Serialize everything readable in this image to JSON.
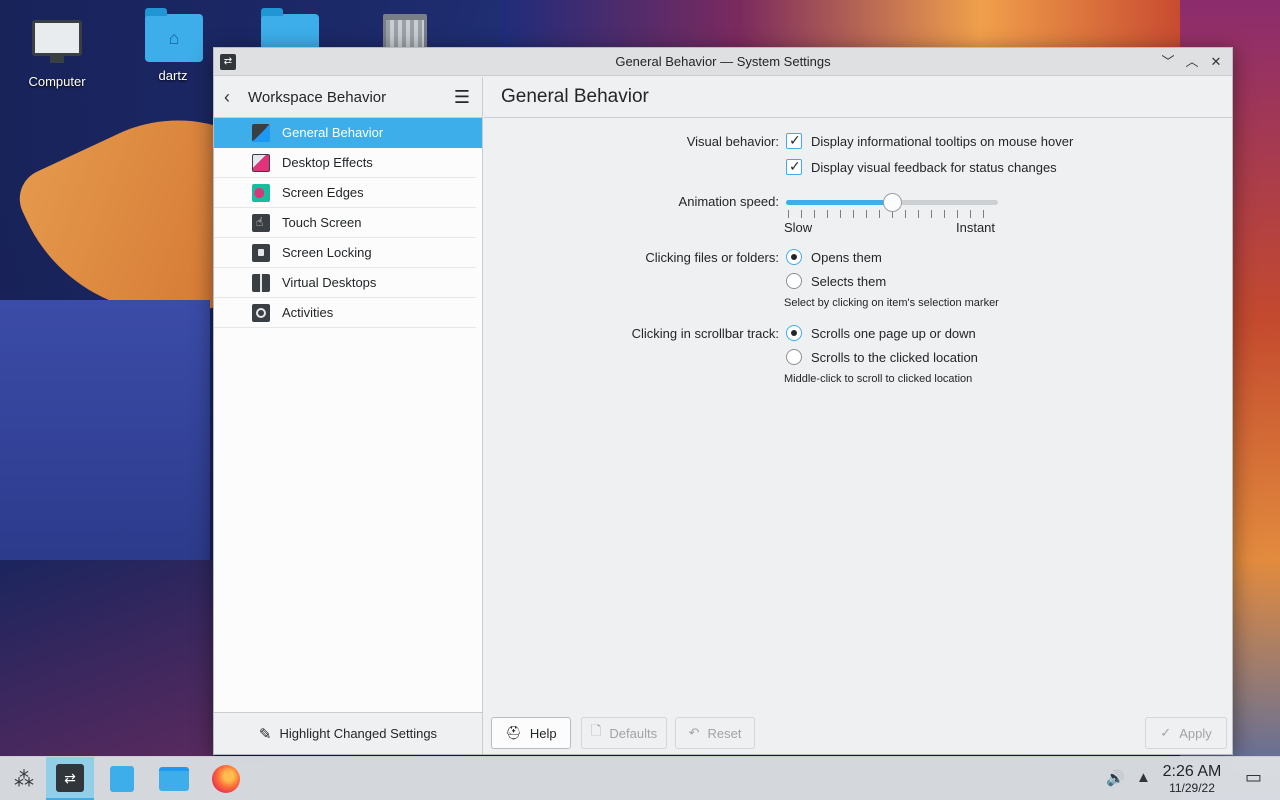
{
  "desktop": {
    "icons": [
      {
        "label": "Computer",
        "icon": "computer-icon"
      },
      {
        "label": "dartz",
        "icon": "home-folder-icon"
      },
      {
        "label": "",
        "icon": "folder-icon"
      },
      {
        "label": "",
        "icon": "trash-icon"
      }
    ]
  },
  "window": {
    "title": "General Behavior — System Settings",
    "controls": [
      "minimize",
      "maximize",
      "close"
    ]
  },
  "sidebar": {
    "back_icon": "chevron-left-icon",
    "title": "Workspace Behavior",
    "menu_icon": "hamburger-icon",
    "items": [
      {
        "label": "General Behavior",
        "active": true
      },
      {
        "label": "Desktop Effects",
        "active": false
      },
      {
        "label": "Screen Edges",
        "active": false
      },
      {
        "label": "Touch Screen",
        "active": false
      },
      {
        "label": "Screen Locking",
        "active": false
      },
      {
        "label": "Virtual Desktops",
        "active": false
      },
      {
        "label": "Activities",
        "active": false
      }
    ],
    "footer_label": "Highlight Changed Settings"
  },
  "main": {
    "title": "General Behavior",
    "visual_behavior": {
      "label": "Visual behavior:",
      "tooltips": {
        "label": "Display informational tooltips on mouse hover",
        "checked": true
      },
      "feedback": {
        "label": "Display visual feedback for status changes",
        "checked": true
      }
    },
    "animation_speed": {
      "label": "Animation speed:",
      "min_label": "Slow",
      "max_label": "Instant",
      "value_fraction": 0.5
    },
    "clicking_files": {
      "label": "Clicking files or folders:",
      "options": [
        {
          "label": "Opens them",
          "checked": true
        },
        {
          "label": "Selects them",
          "checked": false
        }
      ],
      "hint": "Select by clicking on item's selection marker"
    },
    "scrollbar_track": {
      "label": "Clicking in scrollbar track:",
      "options": [
        {
          "label": "Scrolls one page up or down",
          "checked": true
        },
        {
          "label": "Scrolls to the clicked location",
          "checked": false
        }
      ],
      "hint": "Middle-click to scroll to clicked location"
    },
    "buttons": {
      "help": "Help",
      "defaults": "Defaults",
      "reset": "Reset",
      "apply": "Apply"
    }
  },
  "taskbar": {
    "time": "2:26 AM",
    "date": "11/29/22"
  },
  "colors": {
    "accent": "#3daee9",
    "window_bg": "#eff0f1"
  }
}
